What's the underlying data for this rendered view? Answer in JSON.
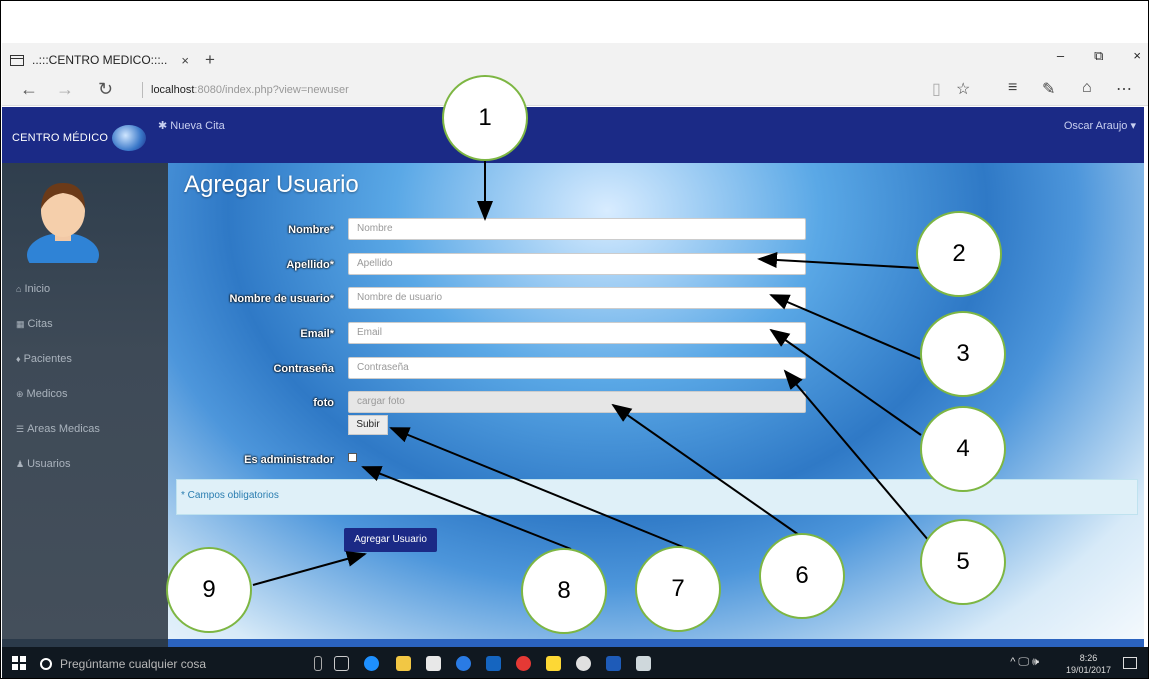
{
  "browser": {
    "tab_title": "..:::CENTRO MEDICO:::..",
    "tab_close": "×",
    "tab_new": "+",
    "address_host": "localhost",
    "address_rest": ":8080/index.php?view=newuser",
    "window_controls": [
      "–",
      "⧉",
      "×"
    ],
    "nav_icons": [
      "back-icon",
      "forward-icon",
      "refresh-icon"
    ],
    "toolbar_icons": [
      "reading-view-icon",
      "favorite-icon",
      "hub-icon",
      "notes-icon",
      "share-icon",
      "more-icon"
    ]
  },
  "navbar": {
    "brand": "CENTRO MÉDICO",
    "new_appointment": "✱ Nueva Cita",
    "user": "Oscar Araujo ▾",
    "color": "#1b2a86"
  },
  "sidebar": {
    "items": [
      {
        "icon": "home-icon",
        "glyph": "⌂",
        "label": "Inicio"
      },
      {
        "icon": "calendar-icon",
        "glyph": "▦",
        "label": "Citas"
      },
      {
        "icon": "person-icon",
        "glyph": "♦",
        "label": "Pacientes"
      },
      {
        "icon": "medic-icon",
        "glyph": "⊕",
        "label": "Medicos"
      },
      {
        "icon": "list-icon",
        "glyph": "☰",
        "label": "Areas Medicas"
      },
      {
        "icon": "users-icon",
        "glyph": "♟",
        "label": "Usuarios"
      }
    ]
  },
  "form": {
    "title": "Agregar Usuario",
    "fields": [
      {
        "label": "Nombre*",
        "placeholder": "Nombre"
      },
      {
        "label": "Apellido*",
        "placeholder": "Apellido"
      },
      {
        "label": "Nombre de usuario*",
        "placeholder": "Nombre de usuario"
      },
      {
        "label": "Email*",
        "placeholder": "Email"
      },
      {
        "label": "Contraseña",
        "placeholder": "Contraseña"
      },
      {
        "label": "foto",
        "placeholder": "cargar foto"
      }
    ],
    "upload_button": "Subir",
    "admin_label": "Es administrador",
    "required_note": "* Campos obligatorios",
    "submit": "Agregar Usuario"
  },
  "taskbar": {
    "search_placeholder": "Pregúntame cualquier cosa",
    "time": "8:26",
    "date": "19/01/2017",
    "tray": "^ 🖵 🕪"
  },
  "callouts": [
    "1",
    "2",
    "3",
    "4",
    "5",
    "6",
    "7",
    "8",
    "9"
  ]
}
